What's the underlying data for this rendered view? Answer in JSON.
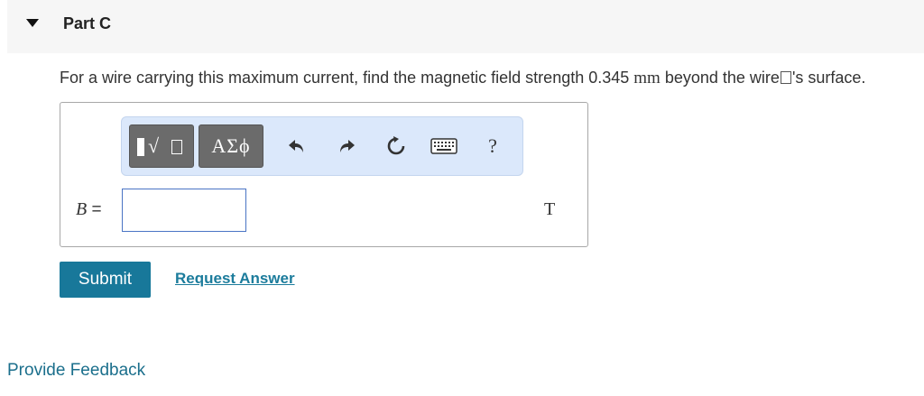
{
  "part": {
    "title": "Part C"
  },
  "question": {
    "text_before": "For a wire carrying this maximum current, find the magnetic field strength 0.345 ",
    "unit_math": "mm",
    "text_mid": " beyond the wire",
    "text_after": "'s surface."
  },
  "toolbar": {
    "greek_label": "ΑΣϕ",
    "help_label": "?",
    "icons": [
      "templates-icon",
      "greek-letters-icon",
      "undo-icon",
      "redo-icon",
      "reset-icon",
      "keyboard-icon",
      "help-icon"
    ]
  },
  "answer": {
    "variable": "B",
    "equals": " =",
    "value": "",
    "unit": "T"
  },
  "buttons": {
    "submit": "Submit",
    "request_answer": "Request Answer"
  },
  "footer": {
    "feedback": "Provide Feedback"
  },
  "colors": {
    "header_bg": "#f6f6f6",
    "toolbar_bg": "#dbe8fb",
    "submit_bg": "#18789a",
    "link": "#1c7c9c",
    "input_border": "#4a74c4"
  }
}
